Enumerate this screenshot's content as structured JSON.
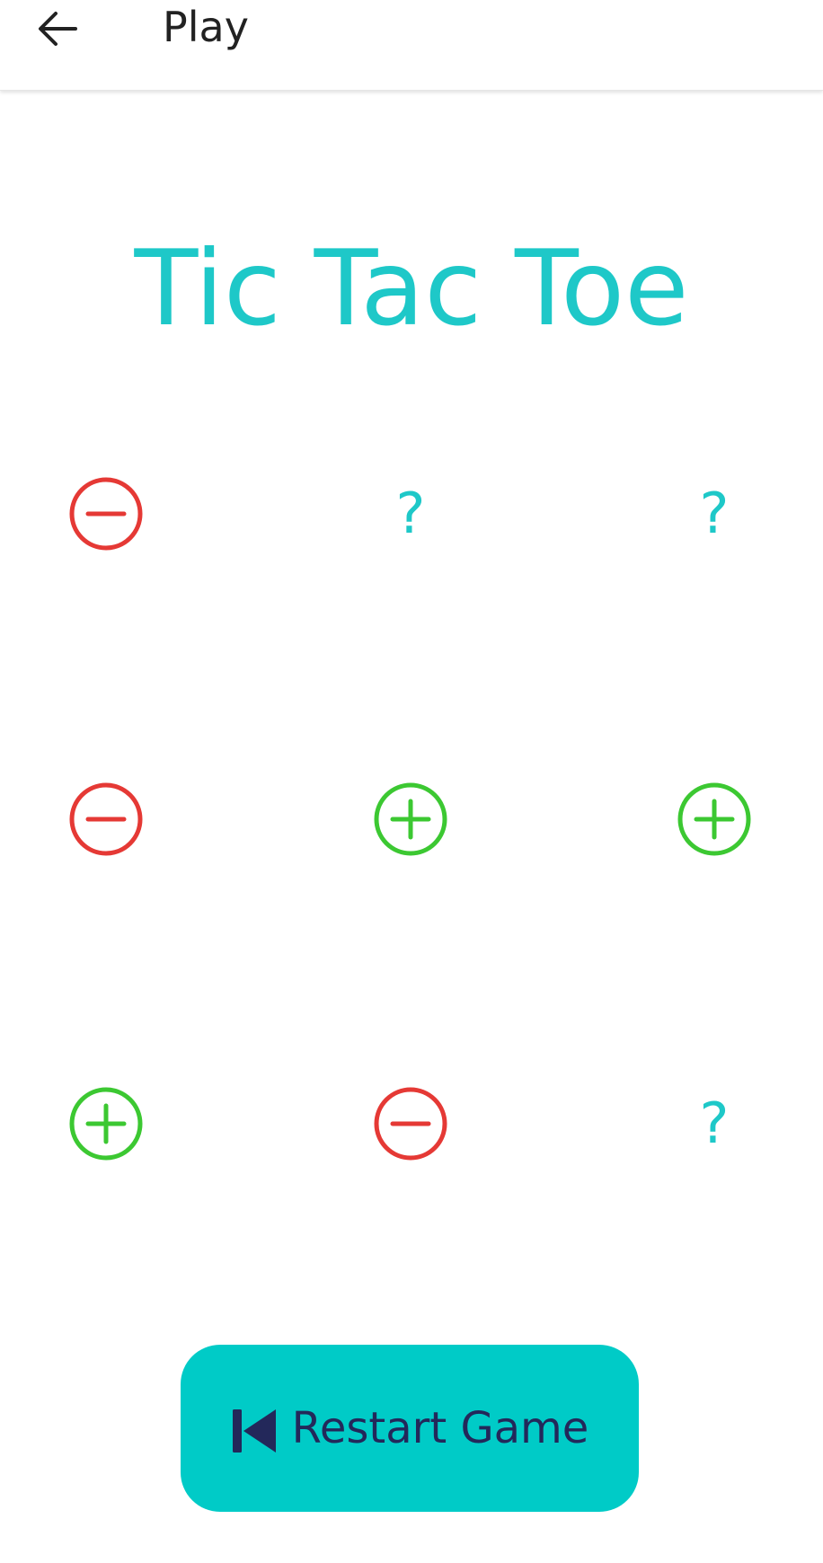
{
  "app_bar": {
    "title": "Play",
    "back_icon": "arrow-left-icon"
  },
  "game": {
    "title": "Tic Tac Toe",
    "board": [
      [
        "minus",
        "unknown",
        "unknown"
      ],
      [
        "minus",
        "plus",
        "plus"
      ],
      [
        "plus",
        "minus",
        "unknown"
      ]
    ],
    "unknown_glyph": "?",
    "icons": {
      "minus": "minus-circle-icon",
      "plus": "plus-circle-icon",
      "unknown": "question-mark-icon"
    }
  },
  "restart_button": {
    "label": "Restart Game",
    "icon": "skip-previous-icon"
  },
  "colors": {
    "accent": "#1ec8c8",
    "button_bg": "#00cbc7",
    "button_text": "#23285a",
    "minus": "#e53935",
    "plus": "#3cc832",
    "title_text": "#222222"
  }
}
